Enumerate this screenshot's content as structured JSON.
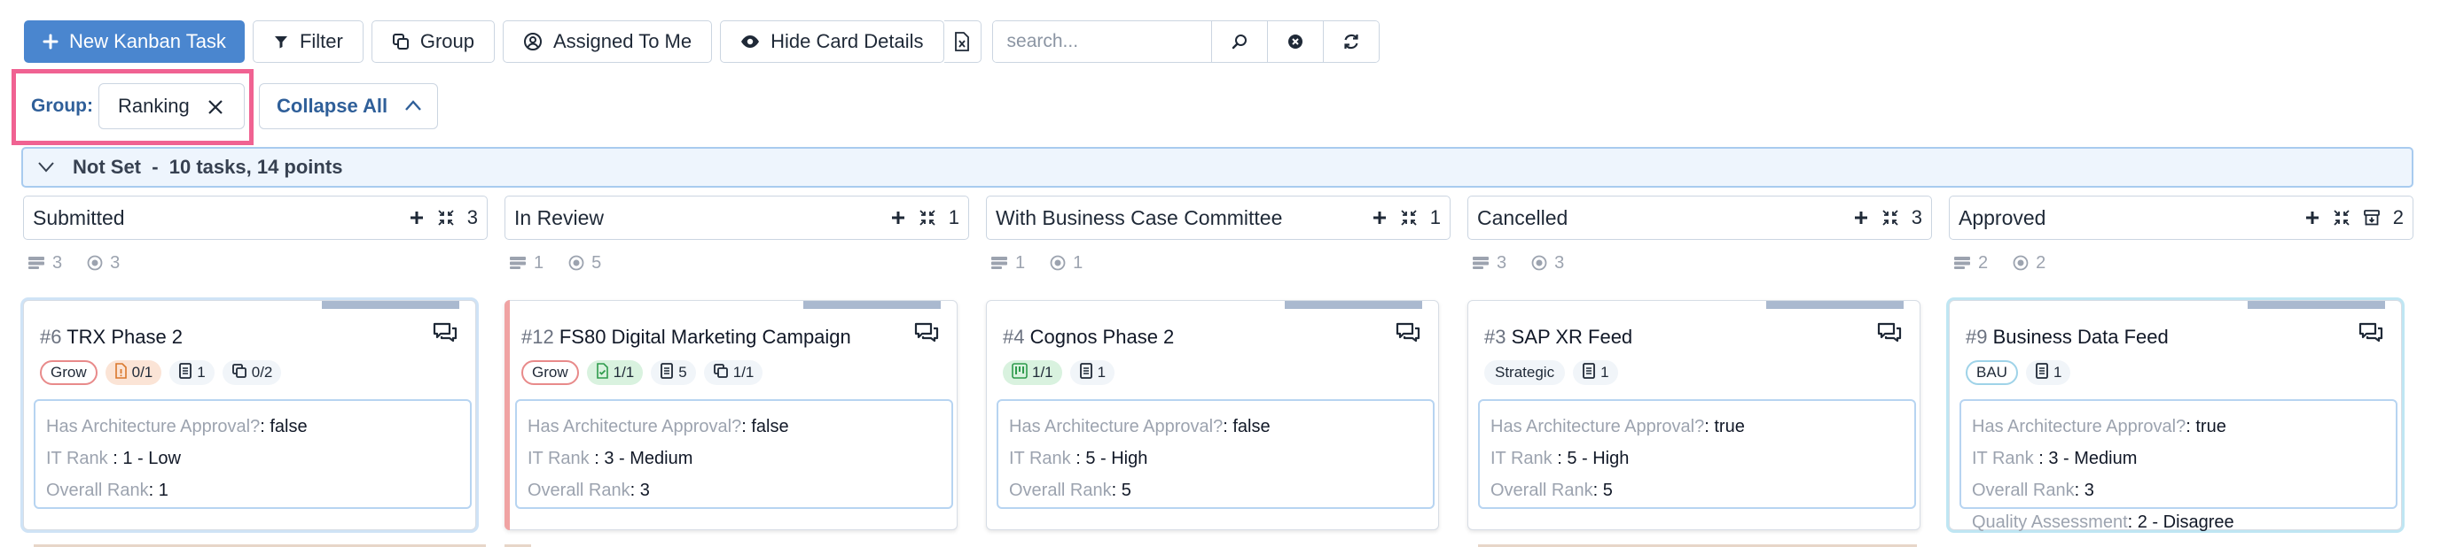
{
  "toolbar": {
    "new_task": "New Kanban Task",
    "filter": "Filter",
    "group": "Group",
    "assigned": "Assigned To Me",
    "hide_details": "Hide Card Details",
    "search_placeholder": "search..."
  },
  "grouping": {
    "label": "Group:",
    "value": "Ranking",
    "collapse": "Collapse All"
  },
  "swimlane": {
    "title": "Not Set  -  10 tasks, 14 points"
  },
  "columns": [
    {
      "name": "Submitted",
      "count": "3",
      "meta_a": "3",
      "meta_b": "3",
      "card": {
        "num": "#6",
        "title": "TRX Phase 2",
        "label": "Grow",
        "label_color": "#e88a8a",
        "badges": [
          {
            "icon": "file-warning-icon",
            "value": "0/1",
            "color": "#fbe4d6"
          },
          {
            "icon": "document-icon",
            "value": "1"
          },
          {
            "icon": "copy-icon",
            "value": "0/2"
          }
        ],
        "details": [
          {
            "k": "Has Architecture Approval?",
            "v": ": false"
          },
          {
            "k": "IT Rank",
            "v": " : 1 - Low"
          },
          {
            "k": "Overall Rank",
            "v": ": 1"
          }
        ],
        "accent": "#cfe3f6"
      }
    },
    {
      "name": "In Review",
      "count": "1",
      "meta_a": "1",
      "meta_b": "5",
      "card": {
        "num": "#12",
        "title": "FS80 Digital Marketing Campaign",
        "label": "Grow",
        "label_color": "#e88a8a",
        "badges": [
          {
            "icon": "file-check-icon",
            "value": "1/1",
            "color": "#d9f2df"
          },
          {
            "icon": "document-icon",
            "value": "5"
          },
          {
            "icon": "copy-icon",
            "value": "1/1"
          }
        ],
        "details": [
          {
            "k": "Has Architecture Approval?",
            "v": ": false"
          },
          {
            "k": "IT Rank",
            "v": " : 3 - Medium"
          },
          {
            "k": "Overall Rank",
            "v": ": 3"
          }
        ],
        "accent": "#f0a3a3"
      }
    },
    {
      "name": "With Business Case Committee",
      "count": "1",
      "meta_a": "1",
      "meta_b": "1",
      "card": {
        "num": "#4",
        "title": "Cognos Phase 2",
        "label": "",
        "label_color": "",
        "badges": [
          {
            "icon": "kanban-icon",
            "value": "1/1",
            "color": "#d9f2df"
          },
          {
            "icon": "document-icon",
            "value": "1"
          }
        ],
        "details": [
          {
            "k": "Has Architecture Approval?",
            "v": ": false"
          },
          {
            "k": "IT Rank",
            "v": " : 5 - High"
          },
          {
            "k": "Overall Rank",
            "v": ": 5"
          }
        ],
        "accent": ""
      }
    },
    {
      "name": "Cancelled",
      "count": "3",
      "meta_a": "3",
      "meta_b": "3",
      "card": {
        "num": "#3",
        "title": "SAP XR Feed",
        "label": "Strategic",
        "label_color": "",
        "badges": [
          {
            "icon": "document-icon",
            "value": "1"
          }
        ],
        "details": [
          {
            "k": "Has Architecture Approval?",
            "v": ": true"
          },
          {
            "k": "IT Rank",
            "v": " : 5 - High"
          },
          {
            "k": "Overall Rank",
            "v": ": 5"
          }
        ],
        "accent": ""
      }
    },
    {
      "name": "Approved",
      "count": "2",
      "meta_a": "2",
      "meta_b": "2",
      "card": {
        "num": "#9",
        "title": "Business Data Feed",
        "label": "BAU",
        "label_color": "#9fd3e8",
        "badges": [
          {
            "icon": "document-icon",
            "value": "1"
          }
        ],
        "details": [
          {
            "k": "Has Architecture Approval?",
            "v": ": true"
          },
          {
            "k": "IT Rank",
            "v": " : 3 - Medium"
          },
          {
            "k": "Overall Rank",
            "v": ": 3"
          },
          {
            "k": "Quality Assessment",
            "v": ": 2 - Disagree"
          }
        ],
        "accent": "#bfe6f3"
      }
    }
  ],
  "colors": {
    "primary": "#4a86cf",
    "highlight": "#f06292",
    "lane_bg": "#eef5fd",
    "lane_border": "#a8cbef"
  }
}
